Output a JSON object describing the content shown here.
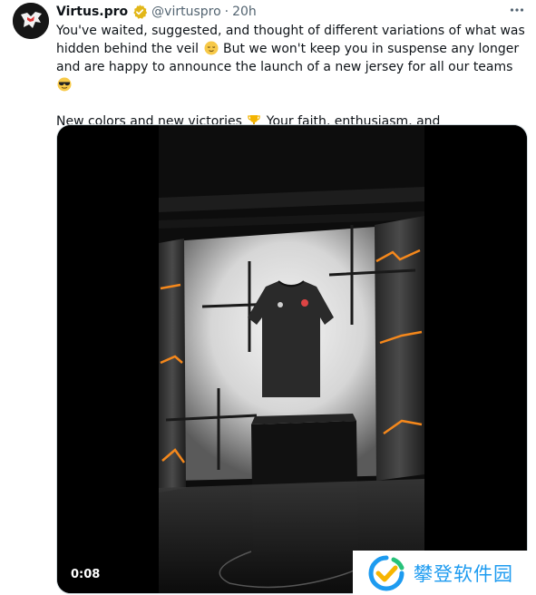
{
  "tweet": {
    "author_name": "Virtus.pro",
    "handle": "@virtuspro",
    "separator": "·",
    "time": "20h",
    "line1": "You've waited, suggested, and thought of different variations of what was",
    "line2_a": "hidden behind the veil",
    "line2_b": "But we won't keep you in suspense any longer",
    "line3": "and are happy to announce the launch of a new jersey for all our teams",
    "line4": "New colors and new victories",
    "line4_b": "Your faith, enthusiasm, and",
    "emojis": [
      "relieved-face",
      "smiling-face-with-sunglasses",
      "trophy"
    ]
  },
  "media": {
    "duration": "0:08"
  },
  "watermark": {
    "text": "攀登软件园"
  },
  "colors": {
    "text": "#0f1419",
    "secondary": "#536471",
    "verified_badge": "#e2b719",
    "accent": "#1d9bf0"
  }
}
